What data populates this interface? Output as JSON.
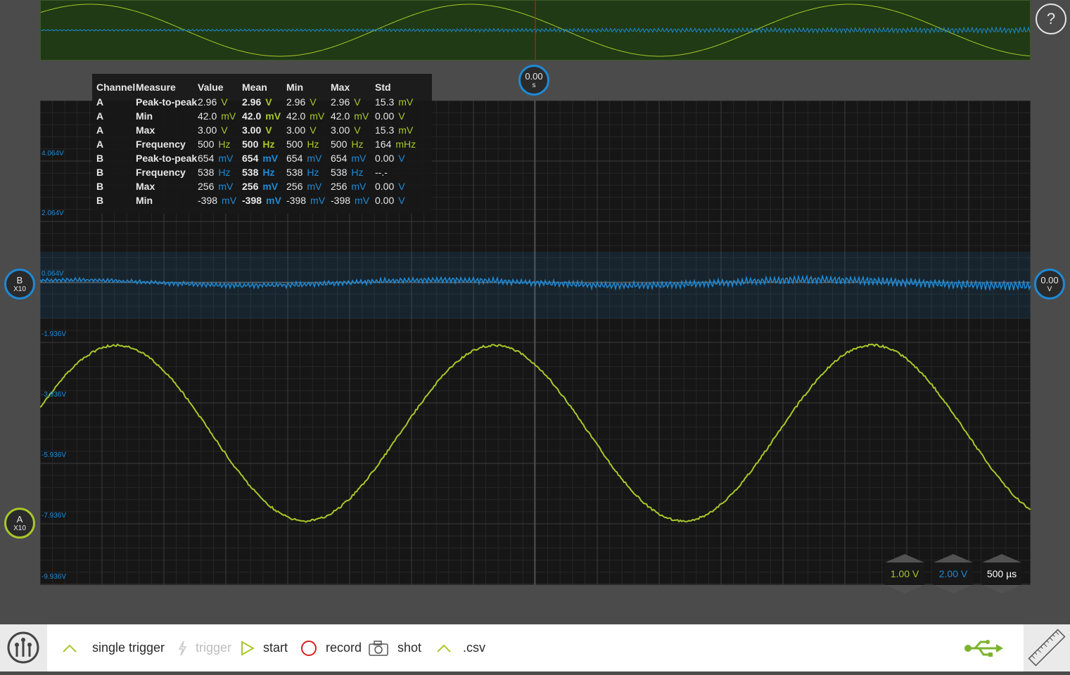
{
  "help": {
    "label": "?"
  },
  "time_marker": {
    "value": "0.00",
    "unit": "s"
  },
  "offset_marker": {
    "value": "0.00",
    "unit": "V"
  },
  "channel_b_marker": {
    "name": "B",
    "probe": "X10"
  },
  "channel_a_marker": {
    "name": "A",
    "probe": "X10"
  },
  "y_axis_labels": [
    "4.064V",
    "2.064V",
    "0.064V",
    "-1.936V",
    "-3.936V",
    "-5.936V",
    "-7.936V",
    "-9.936V"
  ],
  "measurements": {
    "headers": [
      "Channel",
      "Measure",
      "Value",
      "Mean",
      "Min",
      "Max",
      "Std"
    ],
    "rows": [
      {
        "channel": "A",
        "measure": "Peak-to-peak",
        "value": "2.96",
        "value_unit": "V",
        "mean": "2.96",
        "mean_unit": "V",
        "min": "2.96",
        "min_unit": "V",
        "max": "2.96",
        "max_unit": "V",
        "std": "15.3",
        "std_unit": "mV"
      },
      {
        "channel": "A",
        "measure": "Min",
        "value": "42.0",
        "value_unit": "mV",
        "mean": "42.0",
        "mean_unit": "mV",
        "min": "42.0",
        "min_unit": "mV",
        "max": "42.0",
        "max_unit": "mV",
        "std": "0.00",
        "std_unit": "V"
      },
      {
        "channel": "A",
        "measure": "Max",
        "value": "3.00",
        "value_unit": "V",
        "mean": "3.00",
        "mean_unit": "V",
        "min": "3.00",
        "min_unit": "V",
        "max": "3.00",
        "max_unit": "V",
        "std": "15.3",
        "std_unit": "mV"
      },
      {
        "channel": "A",
        "measure": "Frequency",
        "value": "500",
        "value_unit": "Hz",
        "mean": "500",
        "mean_unit": "Hz",
        "min": "500",
        "min_unit": "Hz",
        "max": "500",
        "max_unit": "Hz",
        "std": "164",
        "std_unit": "mHz"
      },
      {
        "channel": "B",
        "measure": "Peak-to-peak",
        "value": "654",
        "value_unit": "mV",
        "mean": "654",
        "mean_unit": "mV",
        "min": "654",
        "min_unit": "mV",
        "max": "654",
        "max_unit": "mV",
        "std": "0.00",
        "std_unit": "V"
      },
      {
        "channel": "B",
        "measure": "Frequency",
        "value": "538",
        "value_unit": "Hz",
        "mean": "538",
        "mean_unit": "Hz",
        "min": "538",
        "min_unit": "Hz",
        "max": "538",
        "max_unit": "Hz",
        "std": "--.-",
        "std_unit": ""
      },
      {
        "channel": "B",
        "measure": "Max",
        "value": "256",
        "value_unit": "mV",
        "mean": "256",
        "mean_unit": "mV",
        "min": "256",
        "min_unit": "mV",
        "max": "256",
        "max_unit": "mV",
        "std": "0.00",
        "std_unit": "V"
      },
      {
        "channel": "B",
        "measure": "Min",
        "value": "-398",
        "value_unit": "mV",
        "mean": "-398",
        "mean_unit": "mV",
        "min": "-398",
        "min_unit": "mV",
        "max": "-398",
        "max_unit": "mV",
        "std": "0.00",
        "std_unit": "V"
      }
    ]
  },
  "scales": {
    "channel_a": "1.00 V",
    "channel_b": "2.00 V",
    "time": "500 µs"
  },
  "toolbar": {
    "single_trigger": "single trigger",
    "trigger": "trigger",
    "start": "start",
    "record": "record",
    "shot": "shot",
    "csv": ".csv"
  },
  "colors": {
    "channel_a": "#a8c82a",
    "channel_b": "#1e8ad6",
    "grid": "#3a3a3a",
    "overview_bg": "#1f3a14",
    "cursor": "#d42020"
  },
  "icons": {
    "logo": "probe-logo-icon",
    "usb": "usb-icon",
    "ruler": "ruler-icon",
    "help": "help-icon"
  }
}
